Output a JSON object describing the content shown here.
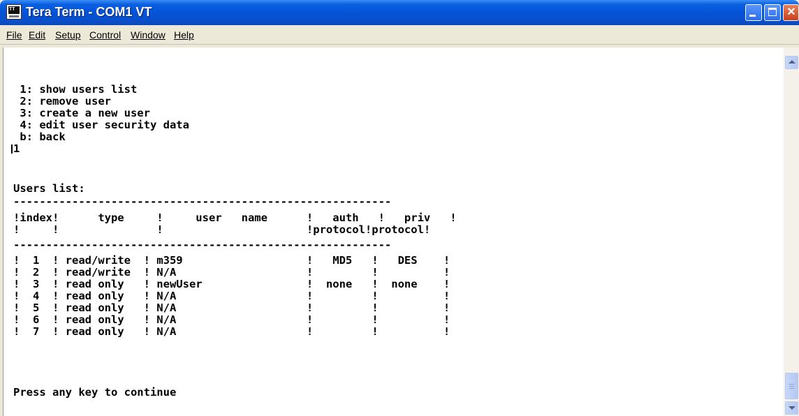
{
  "window": {
    "title": "Tera Term - COM1 VT",
    "icon": "teraterm-app-icon",
    "icon_text": "TT"
  },
  "menubar": {
    "items": [
      {
        "label": "File"
      },
      {
        "label": "Edit"
      },
      {
        "label": "Setup"
      },
      {
        "label": "Control"
      },
      {
        "label": "Window"
      },
      {
        "label": "Help"
      }
    ]
  },
  "terminal": {
    "lines": [
      " 1: show users list",
      " 2: remove user",
      " 3: create a new user",
      " 4: edit user security data",
      " b: back",
      "1",
      "",
      "Users list:",
      "----------------------------------------------------------",
      "!index!      type     !     user   name      !   auth   !   priv   !",
      "!     !               !                      !protocol!protocol!",
      "----------------------------------------------------------",
      "!  1  ! read/write  ! m359                   !   MD5   !   DES    !",
      "!  2  ! read/write  ! N/A                    !         !          !",
      "!  3  ! read only   ! newUser                !  none   !  none    !",
      "!  4  ! read only   ! N/A                    !         !          !",
      "!  5  ! read only   ! N/A                    !         !          !",
      "!  6  ! read only   ! N/A                    !         !          !",
      "!  7  ! read only   ! N/A                    !         !          !",
      "",
      "",
      "Press any key to continue"
    ]
  },
  "colors": {
    "titlebar": "#0353d8",
    "terminal_bg": "#ffffff",
    "terminal_fg": "#000000"
  }
}
